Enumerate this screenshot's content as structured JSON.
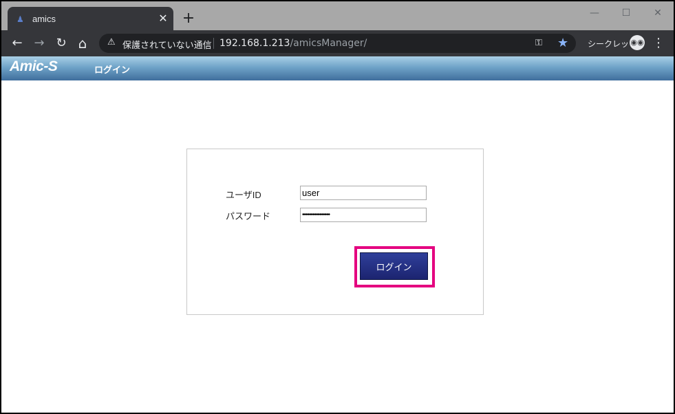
{
  "browser": {
    "tab": {
      "title": "amics",
      "favicon": "amics-favicon-icon",
      "close": "✕"
    },
    "new_tab": "+",
    "window_controls": {
      "minimize": "—",
      "maximize": "☐",
      "close": "✕"
    },
    "nav": {
      "back": "←",
      "forward": "→",
      "reload": "↻",
      "home": "⌂"
    },
    "omnibox": {
      "security_icon": "⚠",
      "security_text": "保護されていない通信",
      "url_host": "192.168.1.213",
      "url_path": "/amicsManager/"
    },
    "key_icon": "⚿",
    "bookmark_star": "★",
    "incognito_label": "シークレット",
    "incognito_icon": "👓",
    "menu_icon": "⋮"
  },
  "app": {
    "brand": "Amic-S",
    "header_title": "ログイン"
  },
  "login_form": {
    "user_id_label": "ユーザID",
    "user_id_value": "user",
    "password_label": "パスワード",
    "password_value": "••••••••••••••••",
    "login_button_label": "ログイン",
    "highlight_color": "#e4007f"
  }
}
